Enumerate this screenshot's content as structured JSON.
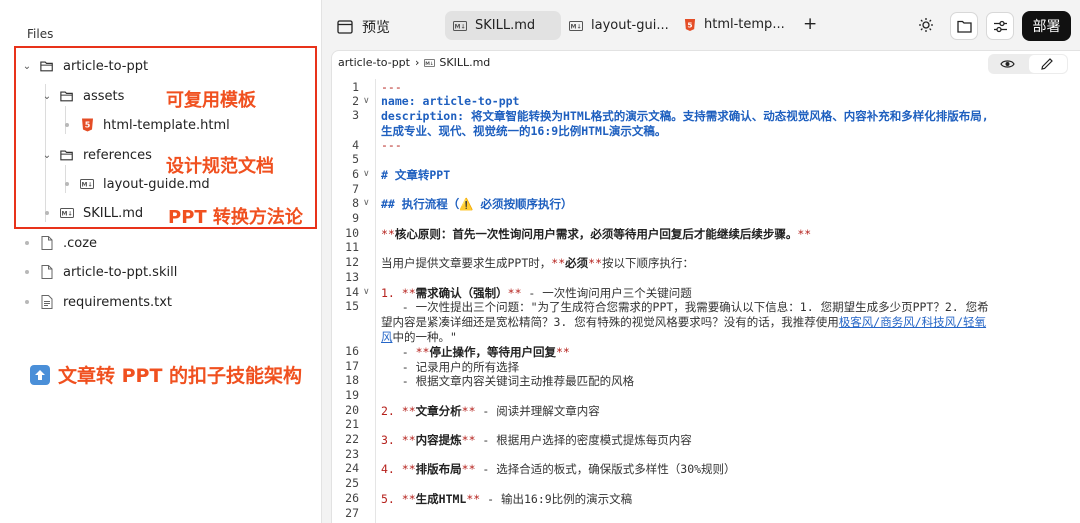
{
  "sidebar": {
    "title": "Files",
    "tree": {
      "root": "article-to-ppt",
      "assets": "assets",
      "html_template": "html-template.html",
      "references": "references",
      "layout_guide": "layout-guide.md",
      "skill": "SKILL.md",
      "coze": ".coze",
      "skill_file": "article-to-ppt.skill",
      "requirements": "requirements.txt"
    },
    "annotations": {
      "assets": "可复用模板",
      "references": "设计规范文档",
      "skill": "PPT 转换方法论",
      "bottom": "文章转 PPT 的扣子技能架构"
    },
    "highlight_color": "#e8321a",
    "annotation_color": "#f0501f"
  },
  "topbar": {
    "preview_label": "预览",
    "tabs": [
      "SKILL.md",
      "layout-gui...",
      "html-temp..."
    ],
    "add_label": "+",
    "deploy_label": "部署"
  },
  "editor": {
    "breadcrumb": [
      "article-to-ppt",
      "SKILL.md"
    ],
    "line_numbers": [
      "1",
      "2",
      "3",
      "4",
      "5",
      "6",
      "7",
      "8",
      "9",
      "10",
      "11",
      "12",
      "13",
      "14",
      "15",
      "16",
      "17",
      "18",
      "19",
      "20",
      "21",
      "22",
      "23",
      "24",
      "25",
      "26",
      "27"
    ],
    "code": {
      "l1": "---",
      "l2": "name: article-to-ppt",
      "l3a": "description: 将文章智能转换为HTML格式的演示文稿。支持需求确认、动态视觉风格、内容补充和多样化排版布局,",
      "l3b": "生成专业、现代、视觉统一的16:9比例HTML演示文稿。",
      "l4": "---",
      "l6": "# 文章转PPT",
      "l8": "## 执行流程（⚠️ 必须按顺序执行）",
      "l10a": "**",
      "l10b": "核心原则：首先一次性询问用户需求，必须等待用户回复后才能继续后续步骤。",
      "l10c": "**",
      "l12a": "当用户提供文章要求生成PPT时，",
      "l12b": "**",
      "l12c": "必须",
      "l12d": "**",
      "l12e": "按以下顺序执行：",
      "l14a": "1. ",
      "l14b": "**",
      "l14c": "需求确认（强制）",
      "l14d": "**",
      "l14e": " - 一次性询问用户三个关键问题",
      "l15a": "   - 一次性提出三个问题：\"为了生成符合您需求的PPT，我需要确认以下信息：1. 您期望生成多少页PPT？2. 您希",
      "l15b": "望内容是紧凑详细还是宽松精简？3. 您有特殊的视觉风格要求吗？没有的话，我推荐使用",
      "l15c": "极客风/商务风/科技风/轻氧",
      "l15d": "风",
      "l15e": "中的一种。\"",
      "l16a": "   - ",
      "l16b": "**",
      "l16c": "停止操作，等待用户回复",
      "l16d": "**",
      "l17": "   - 记录用户的所有选择",
      "l18": "   - 根据文章内容关键词主动推荐最匹配的风格",
      "l20a": "2. ",
      "l20b": "**",
      "l20c": "文章分析",
      "l20d": "**",
      "l20e": " - 阅读并理解文章内容",
      "l22a": "3. ",
      "l22b": "**",
      "l22c": "内容提炼",
      "l22d": "**",
      "l22e": " - 根据用户选择的密度模式提炼每页内容",
      "l24a": "4. ",
      "l24b": "**",
      "l24c": "排版布局",
      "l24d": "**",
      "l24e": " - 选择合适的板式，确保版式多样性（30%规则）",
      "l26a": "5. ",
      "l26b": "**",
      "l26c": "生成HTML",
      "l26d": "**",
      "l26e": " - 输出16:9比例的演示文稿"
    }
  }
}
